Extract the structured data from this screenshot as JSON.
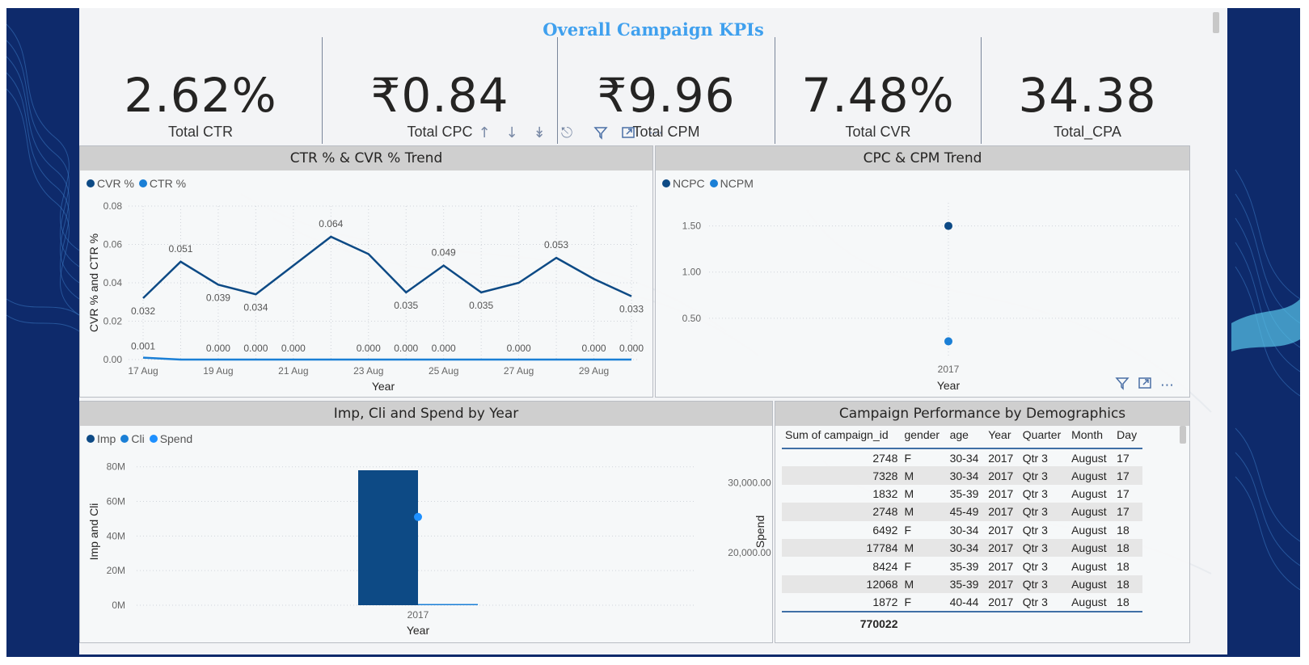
{
  "title": "Overall Campaign KPIs",
  "colors": {
    "backdrop": "#0e2a6b",
    "title": "#3fa0ee",
    "series_dark": "#0d4a85",
    "series_light": "#1a7fd6",
    "series_lighter": "#1e90ff",
    "bar": "#0d4a85"
  },
  "kpis": [
    {
      "value": "2.62%",
      "label": "Total CTR"
    },
    {
      "value": "₹0.84",
      "label": "Total CPC"
    },
    {
      "value": "₹9.96",
      "label": "Total CPM"
    },
    {
      "value": "7.48%",
      "label": "Total CVR"
    },
    {
      "value": "34.38",
      "label": "Total_CPA"
    }
  ],
  "toolbar": {
    "icons": [
      "arrow-up-icon",
      "arrow-down-icon",
      "double-arrow-down-icon",
      "expand-hierarchy-icon",
      "filter-icon",
      "focus-mode-icon",
      "more-options-icon"
    ]
  },
  "panel1": {
    "title": "CTR % & CVR % Trend",
    "legend": [
      "CVR %",
      "CTR %"
    ]
  },
  "panel2": {
    "title": "CPC & CPM Trend",
    "legend": [
      "NCPC",
      "NCPM"
    ]
  },
  "panel3": {
    "title": "Imp, Cli and Spend by Year",
    "legend": [
      "Imp",
      "Cli",
      "Spend"
    ]
  },
  "panel4": {
    "title": "Campaign Performance by Demographics",
    "columns": [
      "Sum of campaign_id",
      "gender",
      "age",
      "Year",
      "Quarter",
      "Month",
      "Day"
    ],
    "rows": [
      [
        "2748",
        "F",
        "30-34",
        "2017",
        "Qtr 3",
        "August",
        "17"
      ],
      [
        "7328",
        "M",
        "30-34",
        "2017",
        "Qtr 3",
        "August",
        "17"
      ],
      [
        "1832",
        "M",
        "35-39",
        "2017",
        "Qtr 3",
        "August",
        "17"
      ],
      [
        "2748",
        "M",
        "45-49",
        "2017",
        "Qtr 3",
        "August",
        "17"
      ],
      [
        "6492",
        "F",
        "30-34",
        "2017",
        "Qtr 3",
        "August",
        "18"
      ],
      [
        "17784",
        "M",
        "30-34",
        "2017",
        "Qtr 3",
        "August",
        "18"
      ],
      [
        "8424",
        "F",
        "35-39",
        "2017",
        "Qtr 3",
        "August",
        "18"
      ],
      [
        "12068",
        "M",
        "35-39",
        "2017",
        "Qtr 3",
        "August",
        "18"
      ],
      [
        "1872",
        "F",
        "40-44",
        "2017",
        "Qtr 3",
        "August",
        "18"
      ]
    ],
    "total": "770022"
  },
  "chart_data": [
    {
      "type": "line",
      "title": "CTR % & CVR % Trend",
      "xlabel": "Year",
      "ylabel": "CVR % and CTR %",
      "x": [
        "17 Aug",
        "18 Aug",
        "19 Aug",
        "20 Aug",
        "21 Aug",
        "22 Aug",
        "23 Aug",
        "24 Aug",
        "25 Aug",
        "26 Aug",
        "27 Aug",
        "28 Aug",
        "29 Aug",
        "30 Aug"
      ],
      "x_ticks": [
        "17 Aug",
        "19 Aug",
        "21 Aug",
        "23 Aug",
        "25 Aug",
        "27 Aug",
        "29 Aug"
      ],
      "ylim": [
        0,
        0.08
      ],
      "y_ticks": [
        "0.00",
        "0.02",
        "0.04",
        "0.06",
        "0.08"
      ],
      "grid": true,
      "legend_position": "top-left",
      "series": [
        {
          "name": "CVR %",
          "values": [
            0.032,
            0.051,
            0.039,
            0.034,
            0.049,
            0.064,
            0.055,
            0.035,
            0.049,
            0.035,
            0.04,
            0.053,
            0.042,
            0.033
          ],
          "labels": [
            "0.032",
            "0.051",
            "0.039",
            "0.034",
            "",
            "0.064",
            "",
            "0.035",
            "0.049",
            "0.035",
            "",
            "0.053",
            "",
            "0.033"
          ]
        },
        {
          "name": "CTR %",
          "values": [
            0.001,
            0.0,
            0.0,
            0.0,
            0.0,
            0.0,
            0.0,
            0.0,
            0.0,
            0.0,
            0.0,
            0.0,
            0.0,
            0.0
          ],
          "labels": [
            "0.001",
            "",
            "0.000",
            "0.000",
            "0.000",
            "",
            "0.000",
            "0.000",
            "0.000",
            "",
            "0.000",
            "",
            "0.000",
            "0.000"
          ]
        }
      ]
    },
    {
      "type": "scatter",
      "title": "CPC & CPM Trend",
      "xlabel": "Year",
      "categories": [
        "2017"
      ],
      "y_ticks": [
        "0.50",
        "1.00",
        "1.50"
      ],
      "ylim": [
        0,
        1.75
      ],
      "grid": true,
      "legend_position": "top-left",
      "series": [
        {
          "name": "NCPC",
          "values": [
            1.5
          ]
        },
        {
          "name": "NCPM",
          "values": [
            0.25
          ]
        }
      ]
    },
    {
      "type": "bar",
      "title": "Imp, Cli and Spend by Year",
      "xlabel": "Year",
      "ylabel": "Imp and Cli",
      "y2label": "Spend",
      "categories": [
        "2017"
      ],
      "y_ticks": [
        "0M",
        "20M",
        "40M",
        "60M",
        "80M"
      ],
      "ylim": [
        0,
        85000000
      ],
      "y2_ticks": [
        "20,000.00",
        "30,000.00"
      ],
      "y2lim": [
        12500,
        33500
      ],
      "grid": true,
      "legend_position": "top-left",
      "series": [
        {
          "name": "Imp",
          "values": [
            78000000
          ]
        },
        {
          "name": "Cli",
          "values": [
            0
          ]
        },
        {
          "name": "Spend",
          "values": [
            25100
          ]
        }
      ]
    }
  ]
}
